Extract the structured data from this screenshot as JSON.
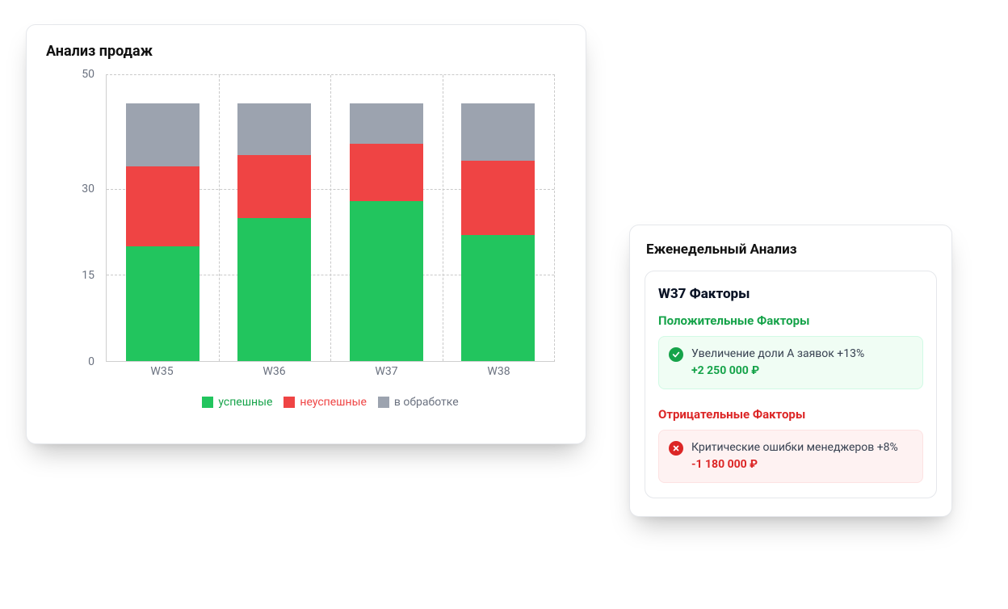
{
  "sales": {
    "title": "Анализ продаж",
    "legend": {
      "success": "успешные",
      "fail": "неуспешные",
      "processing": "в обработке"
    }
  },
  "weekly": {
    "title": "Еженедельный Анализ",
    "inner_title": "W37 Факторы",
    "positive_heading": "Положительные Факторы",
    "negative_heading": "Отрицательные Факторы",
    "positive": {
      "text": "Увеличение доли A заявок +13%",
      "amount": "+2 250 000 ₽"
    },
    "negative": {
      "text": "Критические ошибки менеджеров +8%",
      "amount": "-1 180 000 ₽"
    }
  },
  "chart_data": {
    "type": "bar",
    "stacked": true,
    "title": "Анализ продаж",
    "xlabel": "",
    "ylabel": "",
    "ylim": [
      0,
      50
    ],
    "y_ticks": [
      0,
      15,
      30,
      50
    ],
    "categories": [
      "W35",
      "W36",
      "W37",
      "W38"
    ],
    "series": [
      {
        "name": "успешные",
        "color": "#22c55e",
        "values": [
          20,
          25,
          28,
          22
        ]
      },
      {
        "name": "неуспешные",
        "color": "#ef4444",
        "values": [
          14,
          11,
          10,
          13
        ]
      },
      {
        "name": "в обработке",
        "color": "#9ca3af",
        "values": [
          11,
          9,
          7,
          10
        ]
      }
    ],
    "legend_position": "bottom",
    "grid": true
  }
}
